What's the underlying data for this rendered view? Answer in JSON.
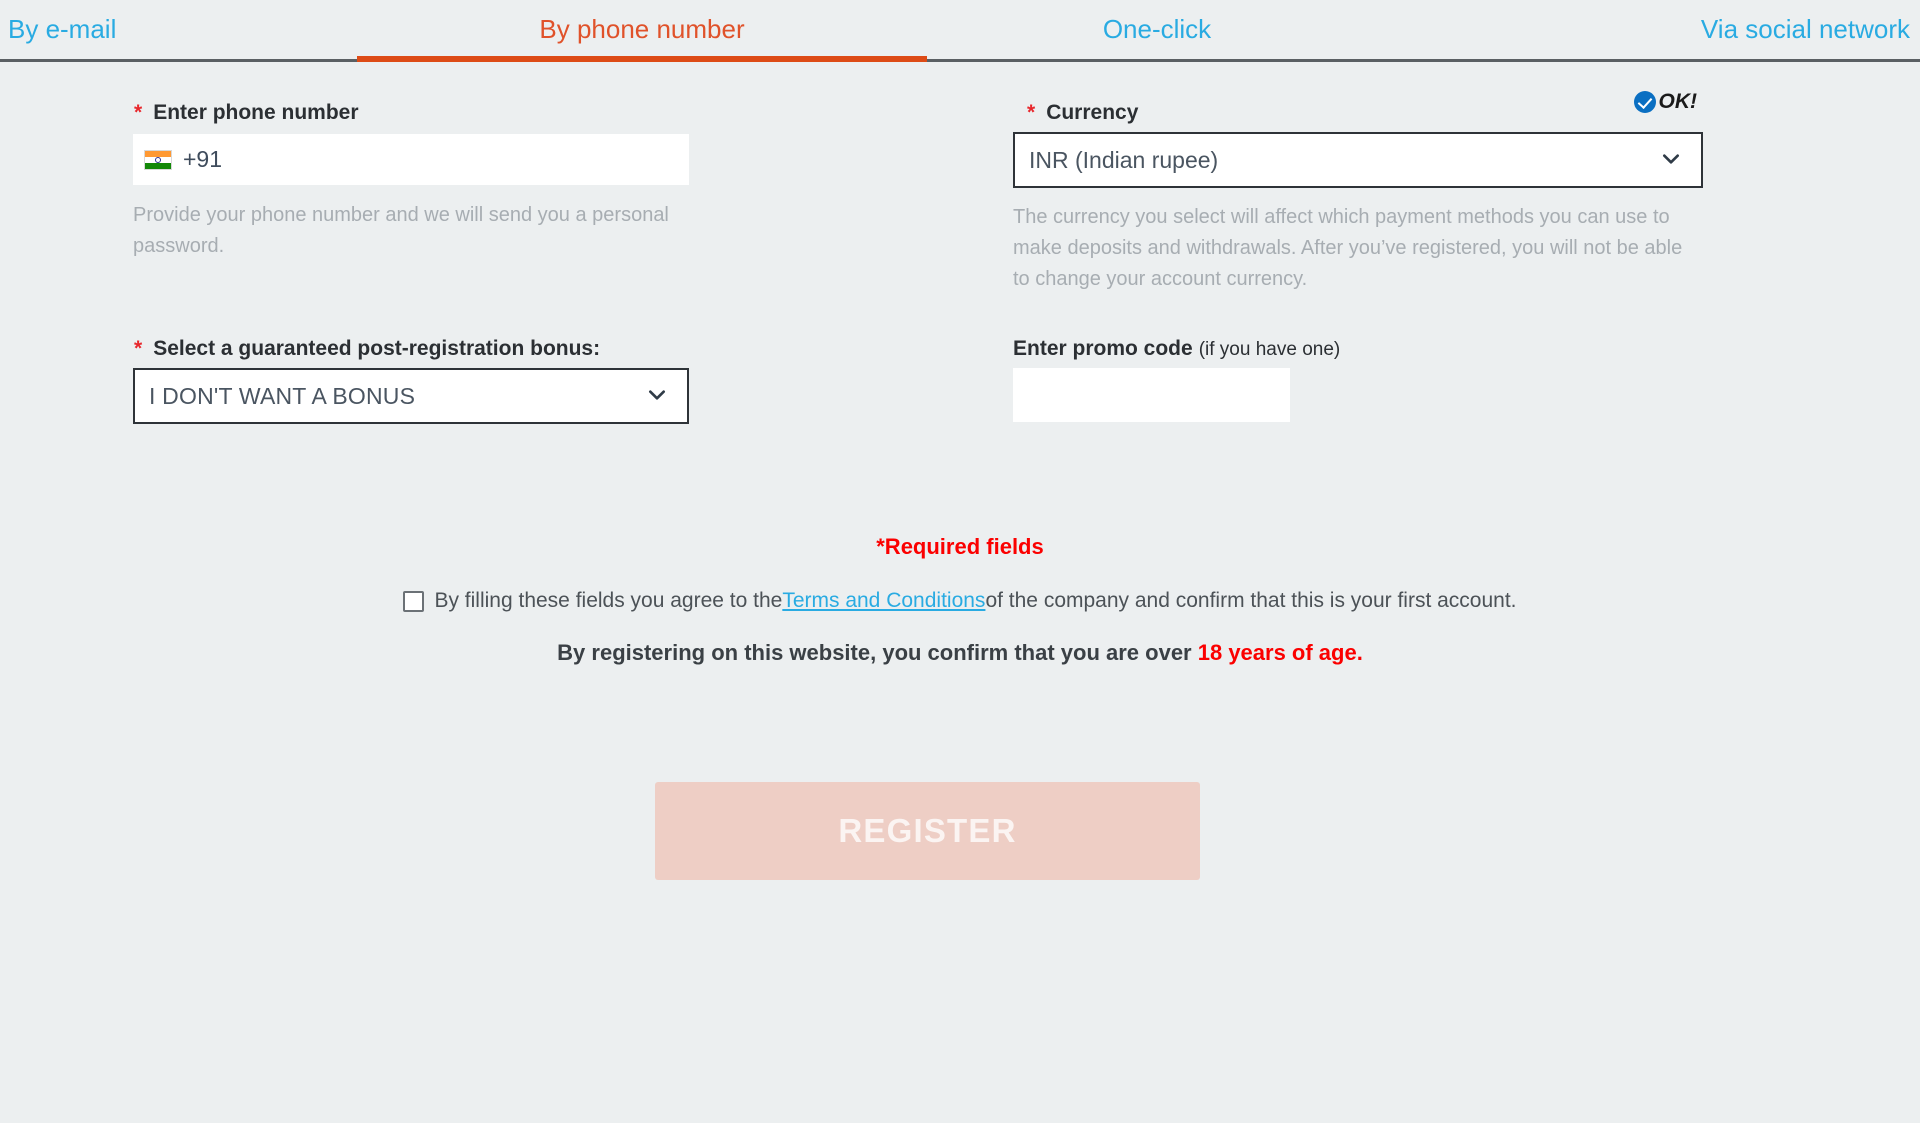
{
  "theme": {
    "page_bg": "#eceff0",
    "tab_inactive_color": "#29abe2",
    "tab_active_color": "#e0522a",
    "tab_underline_color": "#dd4b16",
    "required_color": "#fb0000",
    "link_color": "#29abe2",
    "register_disabled_bg": "#eecec5",
    "ok_badge_color": "#0a6fc2"
  },
  "tabs": [
    {
      "label": "By e-mail",
      "active": false,
      "icon": ""
    },
    {
      "label": "By phone number",
      "active": true,
      "icon": ""
    },
    {
      "label": "One-click",
      "active": false,
      "icon": ""
    },
    {
      "label": "Via social network",
      "active": false,
      "icon": ""
    }
  ],
  "phone": {
    "label": "Enter phone number",
    "required_mark": "*",
    "flag_icon": "india-flag-icon",
    "country_code": "+91",
    "value": "",
    "placeholder": "",
    "helper": "Provide your phone number and we will send you a personal password."
  },
  "currency": {
    "label": "Currency",
    "required_mark": "*",
    "selected": "INR (Indian rupee)",
    "chevron_icon": "chevron-down-icon",
    "status_badge": "OK!",
    "status_icon": "check-circle-icon",
    "helper": "The currency you select will affect which payment methods you can use to make deposits and withdrawals. After you’ve registered, you will not be able to change your account currency."
  },
  "bonus": {
    "label": "Select a guaranteed post-registration bonus:",
    "required_mark": "*",
    "selected": "I DON'T WANT A BONUS",
    "chevron_icon": "chevron-down-icon"
  },
  "promo": {
    "label": "Enter promo code",
    "label_note": "(if you have one)",
    "value": "",
    "placeholder": ""
  },
  "footer": {
    "required_note": "*Required fields",
    "terms_prefix": "By filling these fields you agree to the ",
    "terms_link": "Terms and Conditions",
    "terms_suffix": " of the company and confirm that this is your first account.",
    "checkbox_checked": false,
    "age_prefix": "By registering on this website, you confirm that you are over ",
    "age_highlight": "18 years of age.",
    "register_label": "REGISTER"
  }
}
